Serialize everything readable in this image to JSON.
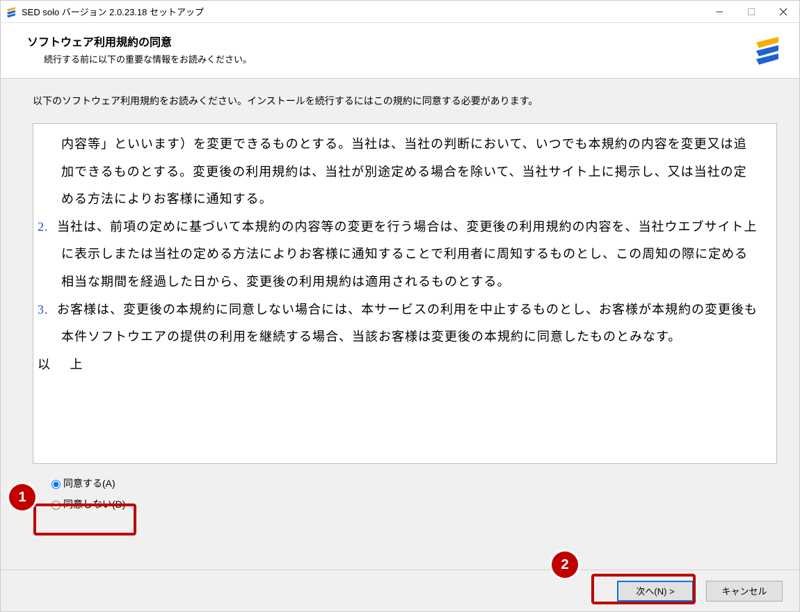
{
  "window": {
    "title": "SED solo バージョン 2.0.23.18 セットアップ"
  },
  "header": {
    "title": "ソフトウェア利用規約の同意",
    "subtitle": "続行する前に以下の重要な情報をお読みください。"
  },
  "instruction": "以下のソフトウェア利用規約をお読みください。インストールを続行するにはこの規約に同意する必要があります。",
  "eula": {
    "pre1": "内容等」といいます）を変更できるものとする。当社は、当社の判断において、いつでも本規約の内容を変更又は追加できるものとする。変更後の利用規約は、当社が別途定める場合を除いて、当社サイト上に掲示し、又は当社の定める方法によりお客様に通知する。",
    "num2": "2.",
    "item2": "当社は、前項の定めに基づいて本規約の内容等の変更を行う場合は、変更後の利用規約の内容を、当社ウエブサイト上に表示しまたは当社の定める方法によりお客様に通知することで利用者に周知するものとし、この周知の際に定める相当な期間を経過した日から、変更後の利用規約は適用されるものとする。",
    "num3": "3.",
    "item3": "お客様は、変更後の本規約に同意しない場合には、本サービスの利用を中止するものとし、お客様が本規約の変更後も本件ソフトウエアの提供の利用を継続する場合、当該お客様は変更後の本規約に同意したものとみなす。",
    "ijou": "以 上"
  },
  "radios": {
    "agree": "同意する(A)",
    "disagree": "同意しない(D)"
  },
  "buttons": {
    "next": "次へ(N) >",
    "cancel": "キャンセル"
  },
  "callouts": {
    "c1": "1",
    "c2": "2"
  }
}
